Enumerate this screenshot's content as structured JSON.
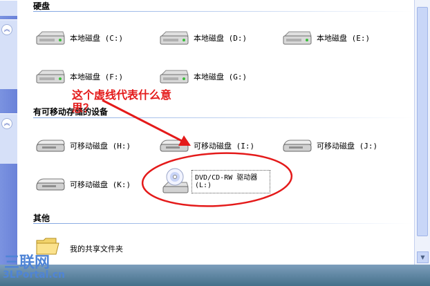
{
  "sections": {
    "hard_disks": {
      "title": "硬盘",
      "drives": [
        {
          "label": "本地磁盘 (C:)"
        },
        {
          "label": "本地磁盘 (D:)"
        },
        {
          "label": "本地磁盘 (E:)"
        },
        {
          "label": "本地磁盘 (F:)"
        },
        {
          "label": "本地磁盘 (G:)"
        }
      ]
    },
    "removable": {
      "title": "有可移动存储的设备",
      "drives": [
        {
          "label": "可移动磁盘 (H:)"
        },
        {
          "label": "可移动磁盘 (I:)"
        },
        {
          "label": "可移动磁盘 (J:)"
        },
        {
          "label": "可移动磁盘 (K:)"
        },
        {
          "label": "DVD/CD-RW 驱动器",
          "label2": "(L:)"
        }
      ]
    },
    "other": {
      "title": "其他",
      "items": [
        {
          "label": "我的共享文件夹"
        }
      ]
    }
  },
  "annotation": {
    "line1": "这个虚线代表什么意",
    "line2": "思？",
    "color": "#e41a1a"
  },
  "watermark": {
    "line1": "三联网",
    "line2": "3LPortal.cn"
  },
  "icons": {
    "collapse": "chevron-up-icon",
    "hdd": "hard-drive-icon",
    "cd": "cd-drive-icon",
    "folder": "shared-folder-icon"
  }
}
